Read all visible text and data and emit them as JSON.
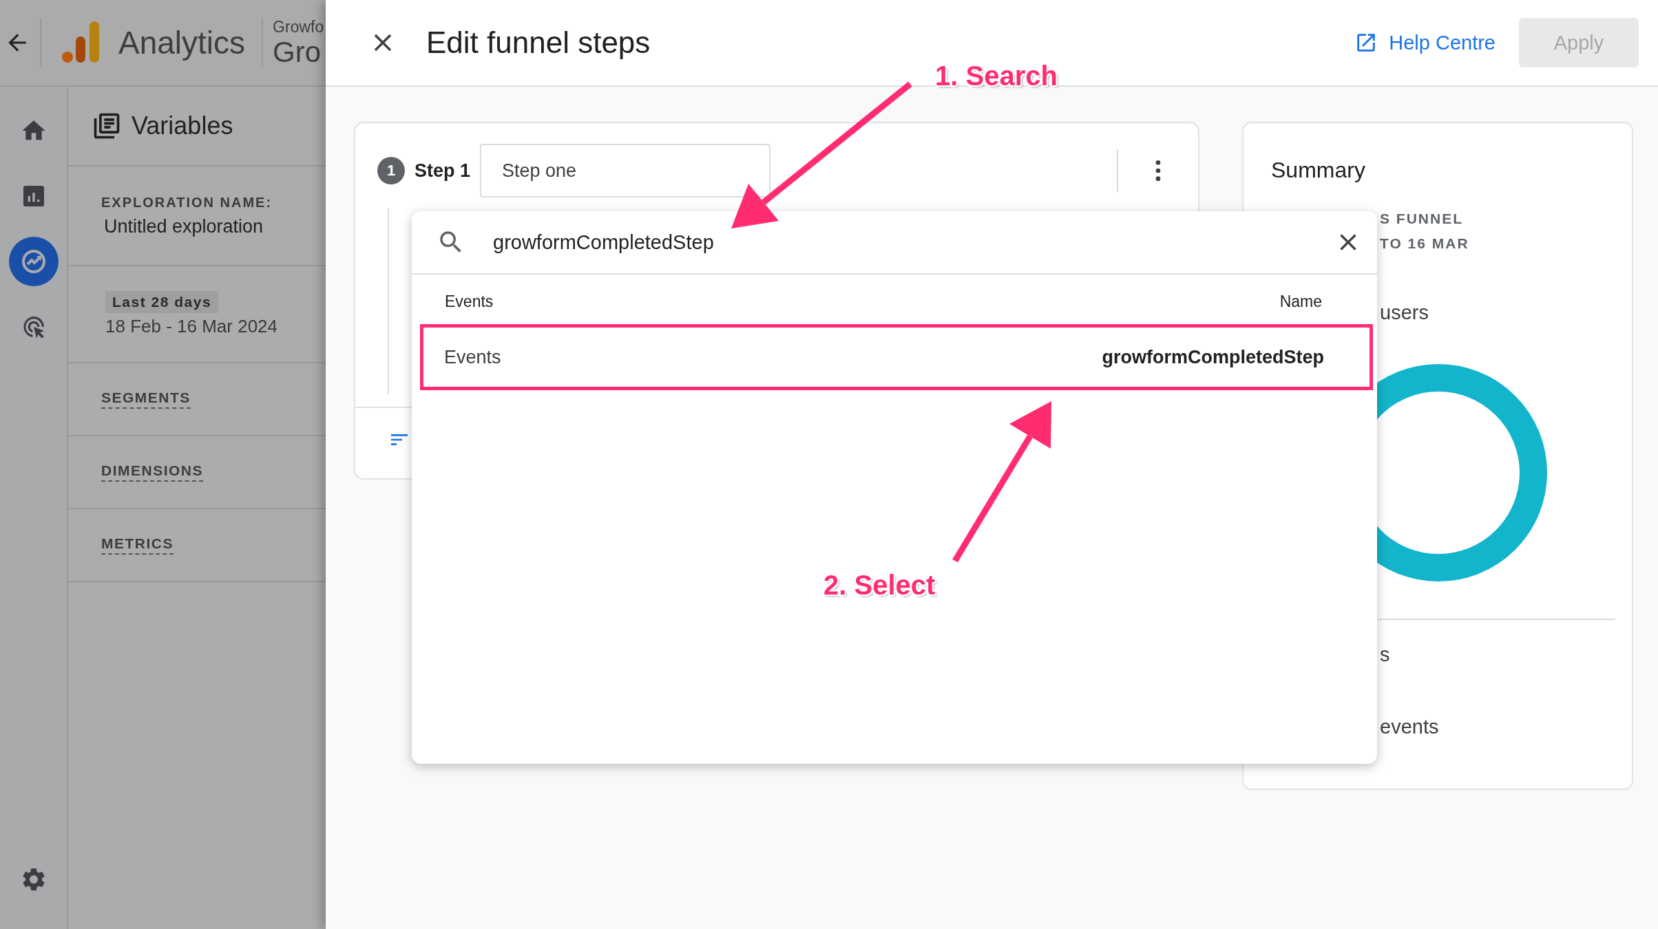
{
  "app_bar": {
    "logo_text": "Analytics",
    "account": "Growfo",
    "property": "Gro"
  },
  "nav_rail": [
    {
      "kind": "home",
      "selected": false
    },
    {
      "kind": "reports",
      "selected": false
    },
    {
      "kind": "explore",
      "selected": true
    },
    {
      "kind": "advertising",
      "selected": false
    }
  ],
  "variables_panel": {
    "title": "Variables",
    "exploration_name_label": "EXPLORATION NAME:",
    "exploration_name": "Untitled exploration",
    "date_chip": "Last 28 days",
    "date_range": "18 Feb - 16 Mar 2024",
    "sections": [
      "SEGMENTS",
      "DIMENSIONS",
      "METRICS"
    ]
  },
  "dialog": {
    "title": "Edit funnel steps",
    "help_link": "Help Centre",
    "apply_button": {
      "label": "Apply",
      "disabled": true
    }
  },
  "step": {
    "number": "1",
    "label": "Step 1",
    "name_value": "Step one"
  },
  "search_dropdown": {
    "query": "growformCompletedStep",
    "columns": [
      "Events",
      "Name"
    ],
    "results": [
      {
        "category": "Events",
        "name": "growformCompletedStep",
        "highlighted": true
      }
    ]
  },
  "summary": {
    "title": "Summary",
    "line_1": "S FUNNEL",
    "line_2": "TO 16 MAR",
    "label_1": "users",
    "label_2": "s",
    "label_3": "events"
  },
  "annotations": [
    {
      "text": "1. Search"
    },
    {
      "text": "2. Select"
    }
  ]
}
